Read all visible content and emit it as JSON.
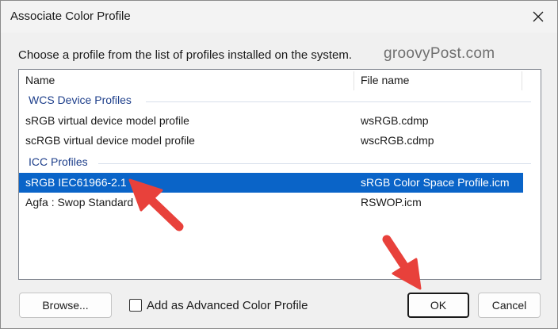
{
  "dialog": {
    "title": "Associate Color Profile",
    "instruction": "Choose a profile from the list of profiles installed on the system.",
    "watermark": "groovyPost.com"
  },
  "list": {
    "columns": [
      "Name",
      "File name"
    ],
    "groups": [
      {
        "label": "WCS Device Profiles",
        "rows": [
          {
            "name": "sRGB virtual device model profile",
            "file": "wsRGB.cdmp"
          },
          {
            "name": "scRGB virtual device model profile",
            "file": "wscRGB.cdmp"
          }
        ]
      },
      {
        "label": "ICC Profiles",
        "rows": [
          {
            "name": "sRGB IEC61966-2.1",
            "file": "sRGB Color Space Profile.icm",
            "selected": true
          },
          {
            "name": "Agfa : Swop Standard",
            "file": "RSWOP.icm"
          }
        ]
      }
    ]
  },
  "buttons": {
    "browse": "Browse...",
    "ok": "OK",
    "cancel": "Cancel"
  },
  "checkbox": {
    "label": "Add as Advanced Color Profile",
    "checked": false
  },
  "colors": {
    "selection": "#0a64c8",
    "group_text": "#1e3f8b",
    "annotation_arrow": "#e8413b"
  },
  "icons": [
    "close-icon",
    "arrow-annotation"
  ]
}
